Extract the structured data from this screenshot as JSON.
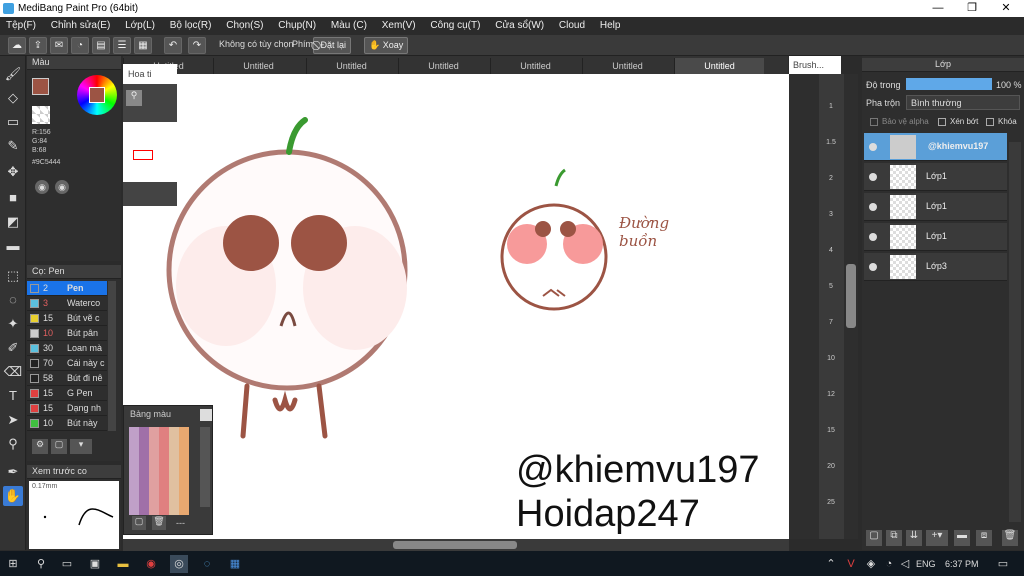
{
  "window": {
    "title": "MediBang Paint Pro (64bit)",
    "min": "—",
    "max": "❐",
    "close": "✕"
  },
  "menu": [
    "Tệp(F)",
    "Chỉnh sửa(E)",
    "Lớp(L)",
    "Bộ lọc(R)",
    "Chọn(S)",
    "Chụp(N)",
    "Màu (C)",
    "Xem(V)",
    "Công cụ(T)",
    "Cửa sổ(W)",
    "Cloud",
    "Help"
  ],
  "toolbar": {
    "no_option": "Không có tùy chọn",
    "key_label": "Phím",
    "redo_label": "Đặt lại",
    "rotate_label": "Xoay"
  },
  "tabs": [
    "Untitled",
    "Untitled",
    "Untitled",
    "Untitled",
    "Untitled",
    "Untitled",
    "Untitled"
  ],
  "color_panel": {
    "title": "Màu",
    "r": "R:156",
    "g": "G:84",
    "b": "B:68",
    "hex": "#9C5444",
    "fg_color": "#9C5444"
  },
  "brush_panel": {
    "title": "Cọ: Pen",
    "items": [
      {
        "size": "2",
        "name": "Pen",
        "color": "#1a73e8"
      },
      {
        "size": "3",
        "name": "Waterco",
        "color": "#5bc0de"
      },
      {
        "size": "15",
        "name": "Bút vẽ c",
        "color": "#e8d030"
      },
      {
        "size": "10",
        "name": "Bút pân",
        "color": "#cccccc"
      },
      {
        "size": "30",
        "name": "Loan mà",
        "color": "#5bc0de"
      },
      {
        "size": "70",
        "name": "Cái này c",
        "color": "#222222"
      },
      {
        "size": "58",
        "name": "Bút đi nê",
        "color": "#222222"
      },
      {
        "size": "15",
        "name": "G Pen",
        "color": "#e04040"
      },
      {
        "size": "15",
        "name": "Dạng nh",
        "color": "#e04040"
      },
      {
        "size": "10",
        "name": "Bút này",
        "color": "#40c040"
      }
    ]
  },
  "preview_panel": {
    "title": "Xem trước co",
    "size": "0.17mm"
  },
  "navigator": {
    "title": "Hoa ti"
  },
  "palette_panel": {
    "title": "Bảng màu",
    "more": "---"
  },
  "brush_size_panel": {
    "title": "Brush...",
    "sizes": [
      "1",
      "1.5",
      "2",
      "3",
      "4",
      "5",
      "7",
      "10",
      "12",
      "15",
      "20",
      "25"
    ]
  },
  "layer_panel": {
    "title": "Lớp",
    "opacity_label": "Độ trong",
    "opacity_value": "100 %",
    "blend_label": "Pha trộn",
    "blend_value": "Bình thường",
    "protect_alpha": "Bảo vệ alpha",
    "clipping": "Xén bớt",
    "lock": "Khóa",
    "layers": [
      "@khiemvu197",
      "Lớp1",
      "Lớp1",
      "Lớp1",
      "Lớp3"
    ]
  },
  "canvas_text": {
    "line1": "@khiemvu197",
    "line2": "Hoidap247",
    "handwritten": "Đường buồn"
  },
  "taskbar": {
    "lang": "ENG",
    "time": "6:37 PM"
  }
}
